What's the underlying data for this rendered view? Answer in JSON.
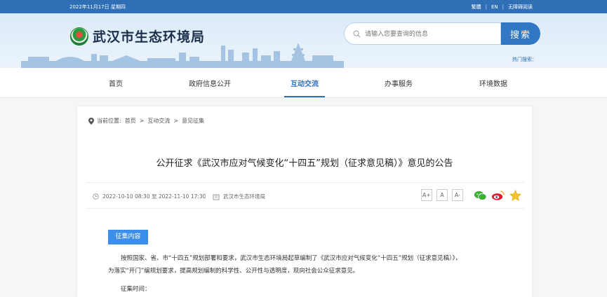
{
  "topbar": {
    "date": "2022年11月17日 星期四",
    "links": [
      "繁體",
      "EN",
      "无障碍阅读"
    ]
  },
  "header": {
    "site_title": "武汉市生态环境局",
    "search_placeholder": "请输入您要查询的信息",
    "search_button": "搜索",
    "hot_search_label": "热门搜索："
  },
  "nav": {
    "items": [
      "首页",
      "政府信息公开",
      "互动交流",
      "办事服务",
      "环境数据"
    ],
    "active": "互动交流"
  },
  "breadcrumb": {
    "label": "当前位置:",
    "items": [
      "首页",
      "互动交流",
      "意见征集"
    ],
    "separator": ">"
  },
  "article": {
    "title": "公开征求《武汉市应对气候变化“十四五”规划（征求意见稿）》意见的公告",
    "date_range": "2022-10-10 08:30 至 2022-11-10 17:30",
    "meta_separator": "|",
    "publisher": "武汉市生态环境局",
    "font_sizes": [
      "A+",
      "A",
      "A-"
    ],
    "share_icons": [
      "wechat-icon",
      "weibo-icon",
      "favorite-star-icon"
    ],
    "section_tag": "征集内容",
    "paragraph_1": "按照国家、省、市“十四五”规划部署和要求，武汉市生态环境局起草编制了《武汉市应对气候变化“十四五”规划（征求意见稿）》，",
    "paragraph_1b": "为落实“开门”编规划要求，提高规划编制的科学性、公开性与透明度，现向社会公众征求意见。",
    "paragraph_2": "征集时间："
  },
  "colors": {
    "primary": "#2f6fb6",
    "tag": "#3b8eea",
    "search_button": "#3177c4"
  }
}
